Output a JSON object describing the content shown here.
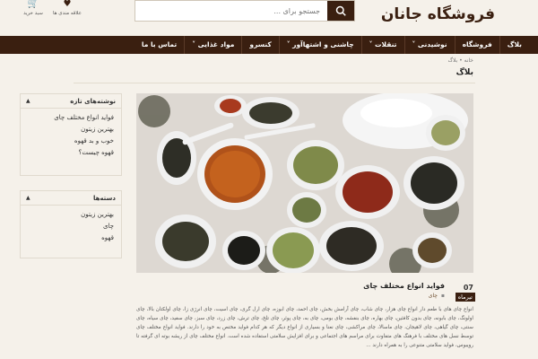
{
  "header": {
    "site_title": "فروشگاه جانان",
    "search_placeholder": "جستجو برای ...",
    "cart_label": "سبد خرید",
    "wishlist_label": "علاقه مندی ها"
  },
  "nav": {
    "items": [
      {
        "label": "بلاگ"
      },
      {
        "label": "فروشگاه"
      },
      {
        "label": "نوشیدنی ˅"
      },
      {
        "label": "تنقلات ˅"
      },
      {
        "label": "چاشنی و اشتهاآور ˅"
      },
      {
        "label": "کنسرو"
      },
      {
        "label": "مواد غذایی ˅"
      },
      {
        "label": "تماس با ما"
      }
    ]
  },
  "breadcrumb": "خانه • بلاگ",
  "page_title": "بلاگ",
  "post": {
    "day": "07",
    "month": "تیرماه",
    "title": "فواید انواع مختلف چای",
    "category": "چای",
    "body": "انواع چای های با طعم دار انواع چای هزار، چای شاب، چای آرامش بخش، چای احمد، چای ابوزه، چای ارل گری، چای اسیت، چای انرژی زا، چای اولکتان بالا، چای اولونگ، چای بابونه، چای بدون کافئین، چای بهاره، چای بنفشه، چای بومی، چای به، چای پوئر، چای تلخ، چای ترش، چای زرد، چای سبز، چای سفید، چای سیاه، چای سنتی، چای گیاهی، چای لاهیجان، چای ماسالا، چای مراکشی، چای نعنا و بسیاری از انواع دیگر که هر کدام فواید مختص به خود را دارند. فواید انواع مختلف چای توسط نسل های مختلف با فرهنگ های متفاوت برای مراسم های اجتماعی و برای افزایش سلامتی استفاده شده است. انواع مختلف چای از ریشه بوته ای گرفته تا رویبوس، فواید سلامتی متنوعی را به همراه دارند ..."
  },
  "sidebar": {
    "recent_posts": {
      "title": "نوشته‌های تازه",
      "items": [
        "فواید انواع مختلف چای",
        "بهترین زیتون",
        "خوب و بد قهوه",
        "قهوه چیست؟"
      ]
    },
    "categories": {
      "title": "دسته‌ها",
      "items": [
        "بهترین زیتون",
        "چای",
        "قهوه"
      ]
    }
  },
  "colors": {
    "brand": "#3a1f10",
    "background": "#f5f1ea"
  }
}
